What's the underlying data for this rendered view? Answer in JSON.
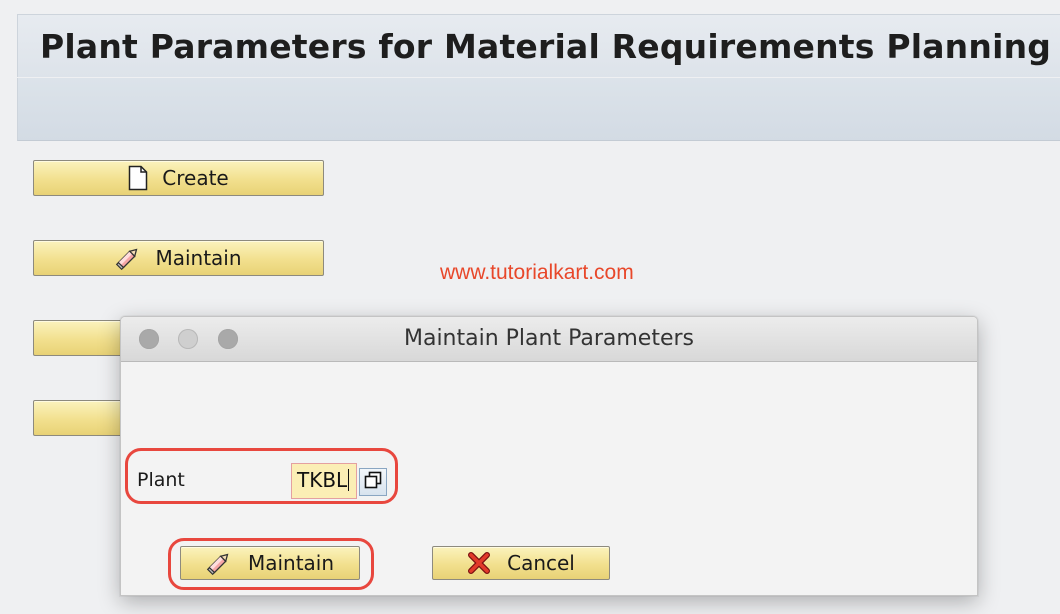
{
  "screen": {
    "title": "Plant Parameters for Material Requirements Planning",
    "buttons": {
      "create": {
        "label": "Create",
        "icon": "document-icon"
      },
      "maintain": {
        "label": "Maintain",
        "icon": "pencil-icon"
      }
    },
    "watermark": "www.tutorialkart.com"
  },
  "dialog": {
    "title": "Maintain Plant Parameters",
    "plant_field": {
      "label": "Plant",
      "value": "TKBL"
    },
    "buttons": {
      "maintain": {
        "label": "Maintain",
        "icon": "pencil-icon"
      },
      "cancel": {
        "label": "Cancel",
        "icon": "red-x-icon"
      }
    }
  },
  "colors": {
    "button_fill": "#f2e08e",
    "input_fill": "#fbeeb5",
    "highlight": "#e8473e",
    "watermark": "#e8472a"
  }
}
